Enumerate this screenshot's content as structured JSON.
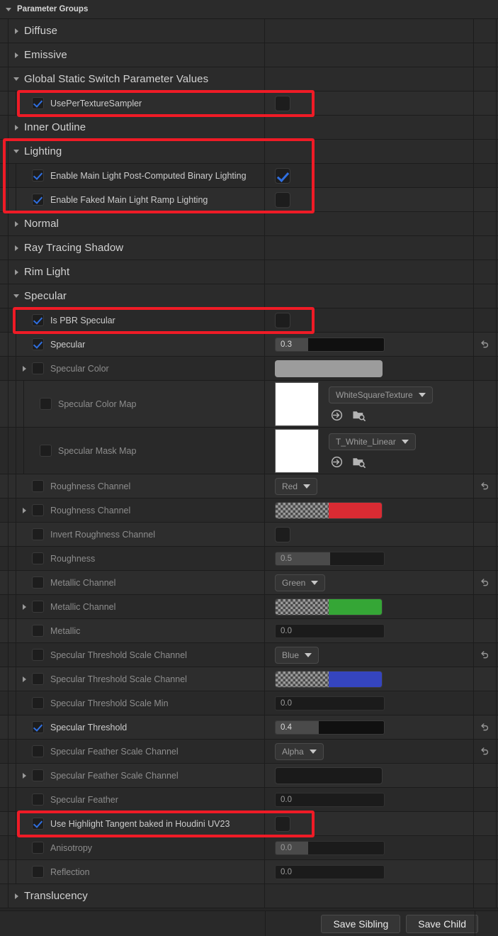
{
  "panel": {
    "title": "Parameter Groups",
    "expander": "chevron-down-icon"
  },
  "footer": {
    "save_sibling": "Save Sibling",
    "save_child": "Save Child"
  },
  "colors": {
    "accent_check": "#2f6fe0",
    "annotation": "#ef1b26",
    "row_bg": "#292929",
    "row_bg_alt": "#2d2d2d",
    "header_bg": "#2b2b2b",
    "red_swatch": "#d92b33",
    "green_swatch": "#35a636",
    "blue_swatch": "#3545bf",
    "grey_swatch": "#9c9c9c"
  },
  "rows": [
    {
      "id": "diffuse",
      "kind": "group",
      "label": "Diffuse",
      "expanded": false
    },
    {
      "id": "emissive",
      "kind": "group",
      "label": "Emissive",
      "expanded": false
    },
    {
      "id": "global-static-switch",
      "kind": "group",
      "label": "Global Static Switch Parameter Values",
      "expanded": true
    },
    {
      "id": "use-per-texture-sampler",
      "kind": "bool",
      "label": "UsePerTextureSampler",
      "override": true,
      "value": false,
      "enabled": true,
      "highlighted": true
    },
    {
      "id": "inner-outline",
      "kind": "group",
      "label": "Inner Outline",
      "expanded": false
    },
    {
      "id": "lighting",
      "kind": "group",
      "label": "Lighting",
      "expanded": true,
      "highlighted": true
    },
    {
      "id": "enable-main-light-post-computed-binary-lighting",
      "kind": "bool",
      "label": "Enable Main Light Post-Computed Binary Lighting",
      "override": true,
      "value": true,
      "enabled": true
    },
    {
      "id": "enable-faked-main-light-ramp-lighting",
      "kind": "bool",
      "label": "Enable Faked Main Light  Ramp Lighting",
      "override": true,
      "value": false,
      "enabled": true
    },
    {
      "id": "normal",
      "kind": "group",
      "label": "Normal",
      "expanded": false
    },
    {
      "id": "ray-tracing-shadow",
      "kind": "group",
      "label": "Ray Tracing Shadow",
      "expanded": false
    },
    {
      "id": "rim-light",
      "kind": "group",
      "label": "Rim Light",
      "expanded": false
    },
    {
      "id": "specular-group",
      "kind": "group",
      "label": "Specular",
      "expanded": true
    },
    {
      "id": "is-pbr-specular",
      "kind": "bool",
      "label": "Is PBR Specular",
      "override": true,
      "value": false,
      "enabled": true,
      "highlighted": true
    },
    {
      "id": "specular",
      "kind": "scalar",
      "label": "Specular",
      "override": true,
      "value": "0.3",
      "fill": 30,
      "enabled": true,
      "reset": true
    },
    {
      "id": "specular-color",
      "kind": "color",
      "label": "Specular Color",
      "override": false,
      "enabled": false,
      "expandable": true,
      "swatch": "grey"
    },
    {
      "id": "specular-color-map",
      "kind": "texture",
      "label": "Specular Color Map",
      "override": false,
      "enabled": false,
      "texture": "WhiteSquareTexture"
    },
    {
      "id": "specular-mask-map",
      "kind": "texture",
      "label": "Specular Mask Map",
      "override": false,
      "enabled": false,
      "texture": "T_White_Linear"
    },
    {
      "id": "roughness-channel-enum",
      "kind": "enum",
      "label": "Roughness Channel",
      "override": false,
      "enabled": false,
      "value": "Red",
      "reset": true
    },
    {
      "id": "roughness-channel-color",
      "kind": "color",
      "label": "Roughness Channel",
      "override": false,
      "enabled": false,
      "expandable": true,
      "swatch": "red"
    },
    {
      "id": "invert-roughness-channel",
      "kind": "bool",
      "label": "Invert Roughness Channel",
      "override": false,
      "value": false,
      "enabled": false
    },
    {
      "id": "roughness",
      "kind": "scalar",
      "label": "Roughness",
      "override": false,
      "value": "0.5",
      "fill": 50,
      "enabled": false
    },
    {
      "id": "metallic-channel-enum",
      "kind": "enum",
      "label": "Metallic Channel",
      "override": false,
      "enabled": false,
      "value": "Green",
      "reset": true
    },
    {
      "id": "metallic-channel-color",
      "kind": "color",
      "label": "Metallic Channel",
      "override": false,
      "enabled": false,
      "expandable": true,
      "swatch": "green"
    },
    {
      "id": "metallic",
      "kind": "scalar",
      "label": "Metallic",
      "override": false,
      "value": "0.0",
      "fill": 0,
      "enabled": false
    },
    {
      "id": "specular-threshold-scale-channel-enum",
      "kind": "enum",
      "label": "Specular Threshold Scale Channel",
      "override": false,
      "enabled": false,
      "value": "Blue",
      "reset": true
    },
    {
      "id": "specular-threshold-scale-channel-color",
      "kind": "color",
      "label": "Specular Threshold Scale Channel",
      "override": false,
      "enabled": false,
      "expandable": true,
      "swatch": "blue"
    },
    {
      "id": "specular-threshold-scale-min",
      "kind": "scalar",
      "label": "Specular Threshold Scale Min",
      "override": false,
      "value": "0.0",
      "fill": 0,
      "enabled": false
    },
    {
      "id": "specular-threshold",
      "kind": "scalar",
      "label": "Specular Threshold",
      "override": true,
      "value": "0.4",
      "fill": 40,
      "enabled": true,
      "reset": true
    },
    {
      "id": "specular-feather-scale-channel-enum",
      "kind": "enum",
      "label": "Specular Feather Scale Channel",
      "override": false,
      "enabled": false,
      "value": "Alpha",
      "reset": true
    },
    {
      "id": "specular-feather-scale-channel-color",
      "kind": "color",
      "label": "Specular Feather Scale Channel",
      "override": false,
      "enabled": false,
      "expandable": true,
      "swatch": "empty"
    },
    {
      "id": "specular-feather",
      "kind": "scalar",
      "label": "Specular Feather",
      "override": false,
      "value": "0.0",
      "fill": 0,
      "enabled": false
    },
    {
      "id": "use-highlight-tangent-baked-in-houdini-uv23",
      "kind": "bool",
      "label": "Use Highlight Tangent baked in Houdini UV23",
      "override": true,
      "value": false,
      "enabled": true,
      "highlighted": true
    },
    {
      "id": "anisotropy",
      "kind": "scalar",
      "label": "Anisotropy",
      "override": false,
      "value": "0.0",
      "fill": 30,
      "enabled": false
    },
    {
      "id": "reflection",
      "kind": "scalar",
      "label": "Reflection",
      "override": false,
      "value": "0.0",
      "fill": 0,
      "enabled": false
    },
    {
      "id": "translucency",
      "kind": "group",
      "label": "Translucency",
      "expanded": false
    }
  ],
  "icons": {
    "reset": "reset-arrow-icon",
    "browse_asset": "browse-to-asset-icon",
    "find_asset": "find-in-content-browser-icon"
  }
}
